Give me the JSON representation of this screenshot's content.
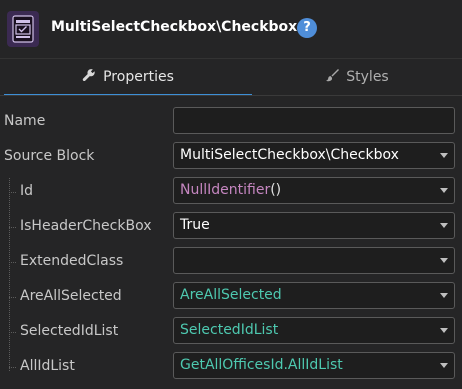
{
  "header": {
    "title": "MultiSelectCheckbox\\Checkbox",
    "help_symbol": "?"
  },
  "tabs": [
    {
      "label": "Properties",
      "icon": "wrench-icon",
      "active": true
    },
    {
      "label": "Styles",
      "icon": "brush-icon",
      "active": false
    }
  ],
  "properties": {
    "name": {
      "label": "Name",
      "value": ""
    },
    "source_block": {
      "label": "Source Block",
      "value": "MultiSelectCheckbox\\Checkbox"
    },
    "id": {
      "label": "Id",
      "value_fn": "NullIdentifier",
      "value_parens": "()"
    },
    "is_header_checkbox": {
      "label": "IsHeaderCheckBox",
      "value": "True"
    },
    "extended_class": {
      "label": "ExtendedClass",
      "value": ""
    },
    "are_all_selected": {
      "label": "AreAllSelected",
      "value": "AreAllSelected"
    },
    "selected_id_list": {
      "label": "SelectedIdList",
      "value": "SelectedIdList"
    },
    "all_id_list": {
      "label": "AllIdList",
      "value_prefix": "GetAllOfficesId",
      "value_suffix": ".AllIdList"
    }
  },
  "colors": {
    "accent": "#3d8fd6",
    "expression_teal": "#4ec9b0",
    "function_purple": "#c586c0",
    "block_icon_bg": "#3b2a52"
  }
}
